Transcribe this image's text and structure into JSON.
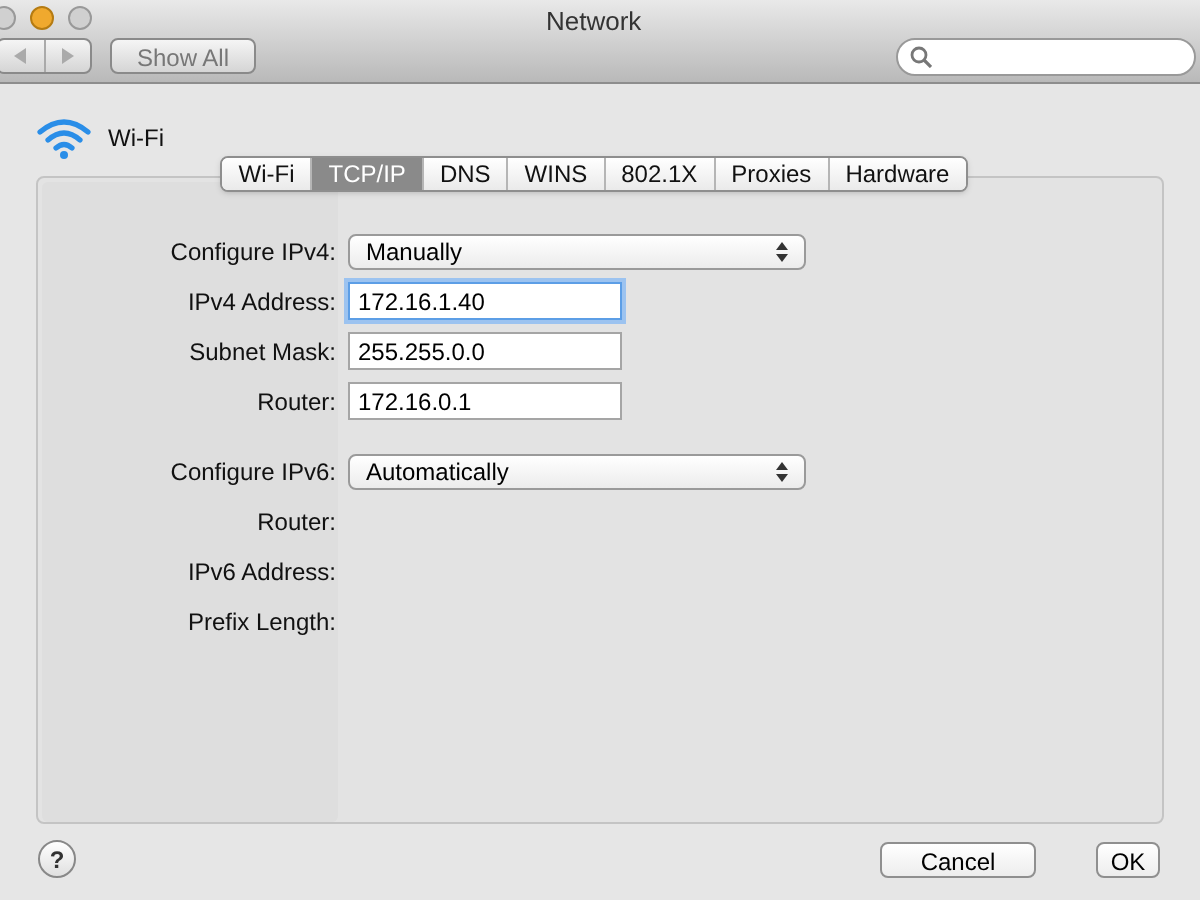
{
  "window": {
    "title": "Network"
  },
  "toolbar": {
    "show_all": "Show All"
  },
  "help": {
    "label": "?"
  },
  "service": {
    "name": "Wi-Fi"
  },
  "tabs": [
    {
      "label": "Wi-Fi",
      "selected": false
    },
    {
      "label": "TCP/IP",
      "selected": true
    },
    {
      "label": "DNS",
      "selected": false
    },
    {
      "label": "WINS",
      "selected": false
    },
    {
      "label": "802.1X",
      "selected": false
    },
    {
      "label": "Proxies",
      "selected": false
    },
    {
      "label": "Hardware",
      "selected": false
    }
  ],
  "form": [
    {
      "kind": "popup",
      "label": "Configure IPv4:",
      "value": "Manually"
    },
    {
      "kind": "field",
      "label": "IPv4 Address:",
      "value": "172.16.1.40",
      "focused": true
    },
    {
      "kind": "field",
      "label": "Subnet Mask:",
      "value": "255.255.0.0",
      "focused": false
    },
    {
      "kind": "field",
      "label": "Router:",
      "value": "172.16.0.1",
      "focused": false
    },
    {
      "kind": "popup",
      "label": "Configure IPv6:",
      "value": "Automatically"
    },
    {
      "kind": "info",
      "label": "Router:"
    },
    {
      "kind": "info",
      "label": "IPv6 Address:"
    },
    {
      "kind": "info",
      "label": "Prefix Length:"
    }
  ],
  "buttons": [
    {
      "label": "Cancel",
      "default": false
    },
    {
      "label": "OK",
      "default": false
    }
  ]
}
